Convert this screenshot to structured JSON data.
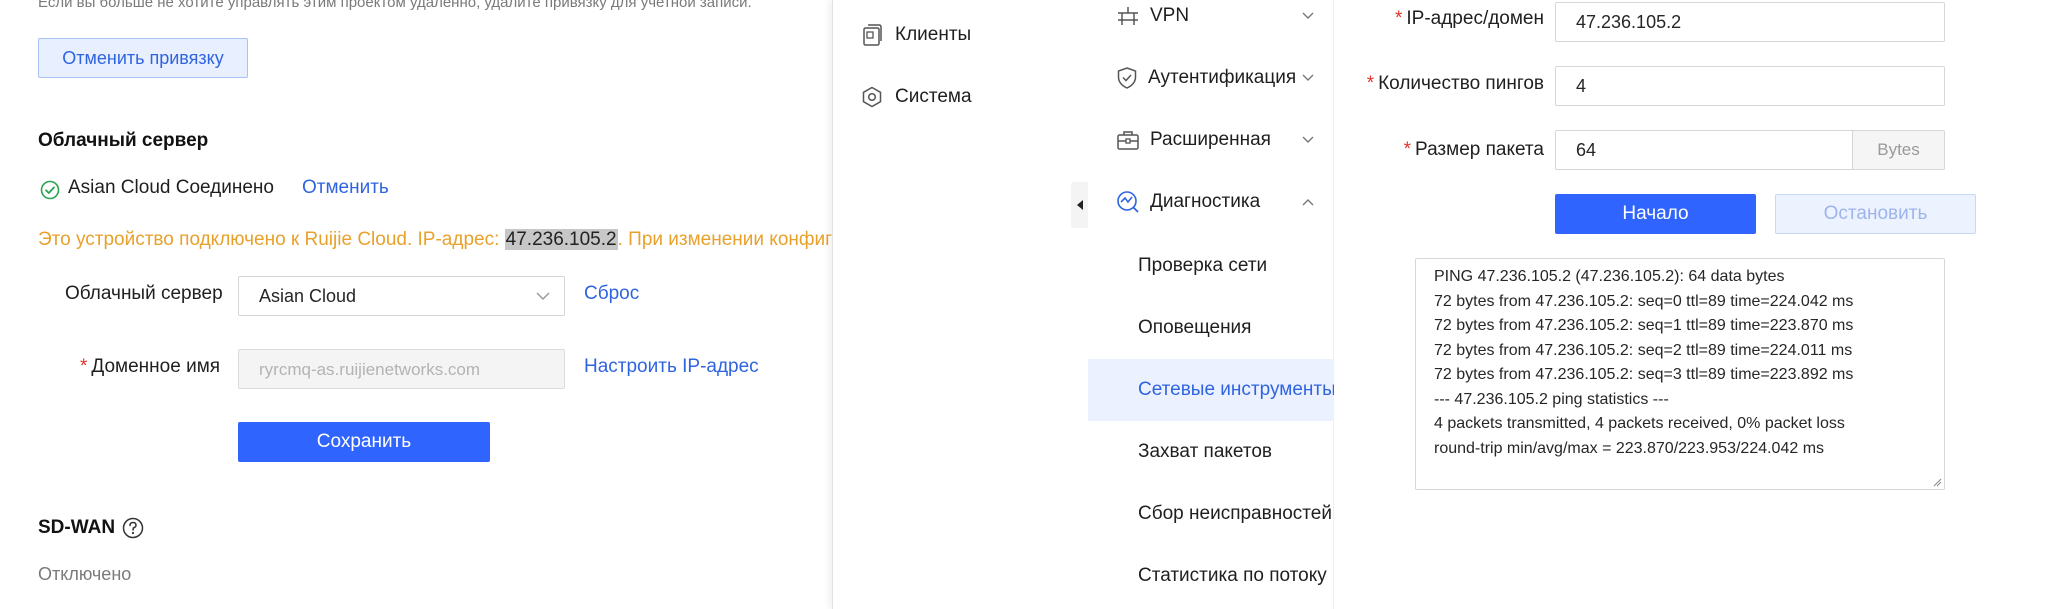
{
  "left": {
    "top_note": "Если вы больше не хотите управлять этим проектом удаленно, удалите привязку для учетной записи.",
    "unbind_button": "Отменить привязку",
    "cloud_section_title": "Облачный сервер",
    "cloud_status": "Asian Cloud Соединено",
    "cancel_link": "Отменить",
    "warning_prefix": "Это устройство подключено к Ruijie Cloud. IP-адрес: ",
    "warning_ip": "47.236.105.2",
    "warning_suffix": ". При изменении конфигурации...",
    "server_label": "Облачный сервер",
    "server_value": "Asian Cloud",
    "reset_link": "Сброс",
    "domain_label": "Доменное имя",
    "domain_placeholder": "ryrcmq-as.ruijienetworks.com",
    "configure_ip_link": "Настроить IP-адрес",
    "save_button": "Сохранить",
    "sdwan_title": "SD-WAN",
    "sdwan_status": "Отключено"
  },
  "nav": {
    "items": [
      {
        "label": "Клиенты",
        "icon": "clients-icon"
      },
      {
        "label": "Система",
        "icon": "system-icon"
      }
    ]
  },
  "submenu": {
    "groups": [
      {
        "label": "VPN",
        "icon": "vpn-icon",
        "expanded": false
      },
      {
        "label": "Аутентификация",
        "icon": "shield-icon",
        "expanded": false
      },
      {
        "label": "Расширенная",
        "icon": "toolbox-icon",
        "expanded": false
      },
      {
        "label": "Диагностика",
        "icon": "diagnostics-icon",
        "expanded": true
      }
    ],
    "items": [
      {
        "label": "Проверка сети",
        "active": false
      },
      {
        "label": "Оповещения",
        "active": false
      },
      {
        "label": "Сетевые инструменты",
        "active": true
      },
      {
        "label": "Захват пакетов",
        "active": false
      },
      {
        "label": "Сбор неисправностей",
        "active": false
      },
      {
        "label": "Статистика по потоку",
        "active": false
      }
    ]
  },
  "ping_form": {
    "ip_label": "IP-адрес/домен",
    "ip_value": "47.236.105.2",
    "count_label": "Количество пингов",
    "count_value": "4",
    "size_label": "Размер пакета",
    "size_value": "64",
    "size_unit": "Bytes",
    "start_button": "Начало",
    "stop_button": "Остановить",
    "output_lines": [
      "PING 47.236.105.2 (47.236.105.2): 64 data bytes",
      "72 bytes from 47.236.105.2: seq=0 ttl=89 time=224.042 ms",
      "72 bytes from 47.236.105.2: seq=1 ttl=89 time=223.870 ms",
      "72 bytes from 47.236.105.2: seq=2 ttl=89 time=224.011 ms",
      "72 bytes from 47.236.105.2: seq=3 ttl=89 time=223.892 ms",
      "",
      "--- 47.236.105.2 ping statistics ---",
      "4 packets transmitted, 4 packets received, 0% packet loss",
      "round-trip min/avg/max = 223.870/223.953/224.042 ms"
    ]
  },
  "colors": {
    "accent": "#2f64ff",
    "link": "#2f64e0",
    "warning": "#e8a12b",
    "success": "#2aa44f",
    "required": "#e0352b"
  }
}
